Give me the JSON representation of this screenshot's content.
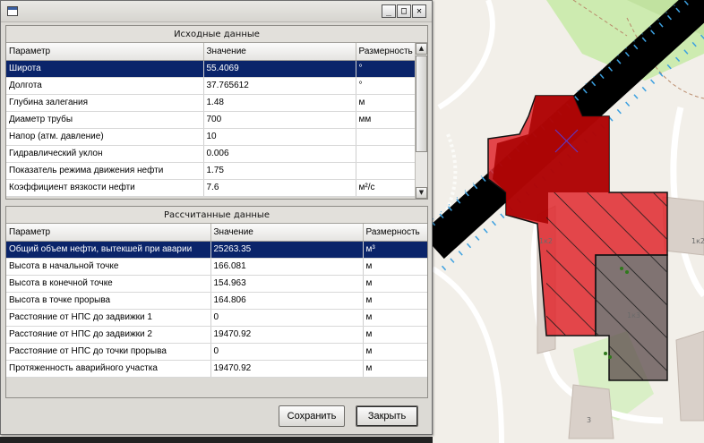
{
  "window": {
    "buttons": {
      "minimize": "_",
      "maximize": "□",
      "close": "✕"
    },
    "icon": "app-icon"
  },
  "input_panel": {
    "title": "Исходные данные",
    "columns": [
      "Параметр",
      "Значение",
      "Размерность"
    ],
    "rows": [
      {
        "param": "Широта",
        "value": "55.4069",
        "unit": "°"
      },
      {
        "param": "Долгота",
        "value": "37.765612",
        "unit": "°"
      },
      {
        "param": "Глубина залегания",
        "value": "1.48",
        "unit": "м"
      },
      {
        "param": "Диаметр трубы",
        "value": "700",
        "unit": "мм"
      },
      {
        "param": "Напор (атм. давление)",
        "value": "10",
        "unit": ""
      },
      {
        "param": "Гидравлический уклон",
        "value": "0.006",
        "unit": ""
      },
      {
        "param": "Показатель режима движения нефти",
        "value": "1.75",
        "unit": ""
      },
      {
        "param": "Коэффициент вязкости нефти",
        "value": "7.6",
        "unit": "м²/с"
      }
    ],
    "selected_row": 0
  },
  "output_panel": {
    "title": "Рассчитанные данные",
    "columns": [
      "Параметр",
      "Значение",
      "Размерность"
    ],
    "rows": [
      {
        "param": "Общий объем нефти, вытекшей при аварии",
        "value": "25263.35",
        "unit": "м³"
      },
      {
        "param": "Высота в начальной точке",
        "value": "166.081",
        "unit": "м"
      },
      {
        "param": "Высота в конечной точке",
        "value": "154.963",
        "unit": "м"
      },
      {
        "param": "Высота в точке прорыва",
        "value": "164.806",
        "unit": "м"
      },
      {
        "param": "Расстояние от НПС до задвижки 1",
        "value": "0",
        "unit": "м"
      },
      {
        "param": "Расстояние от НПС до задвижки 2",
        "value": "19470.92",
        "unit": "м"
      },
      {
        "param": "Расстояние от НПС до точки прорыва",
        "value": "0",
        "unit": "м"
      },
      {
        "param": "Протяженность аварийного участка",
        "value": "19470.92",
        "unit": "м"
      }
    ],
    "selected_row": 0
  },
  "buttons": {
    "save": "Сохранить",
    "close": "Закрыть"
  },
  "map": {
    "labels": [
      "1к2",
      "1к2",
      "1к3",
      "3"
    ],
    "colors": {
      "background": "#f2efe9",
      "park": "#cdebb0",
      "building": "#d9d0c9",
      "pipeline": "#000000",
      "spill": "#e0282e",
      "spill_dark": "#a80000",
      "hatch_area": "#5a4a4a"
    }
  },
  "colors": {
    "selection": "#0a246a",
    "window": "#dcdad5"
  }
}
